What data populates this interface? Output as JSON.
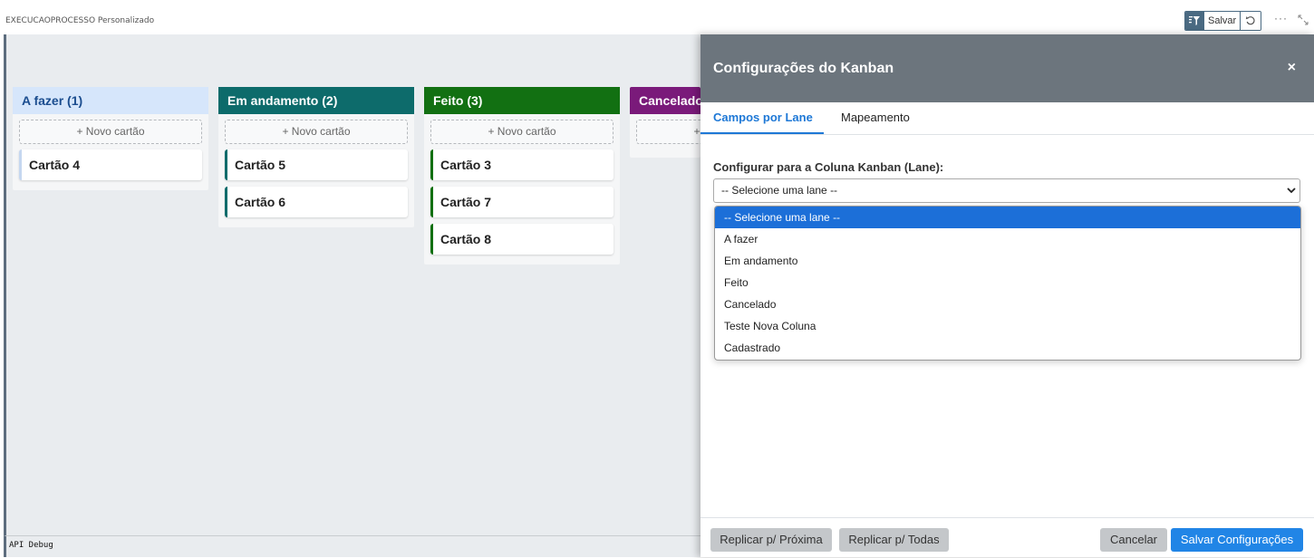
{
  "app": {
    "title": "EXECUCAOPROCESSO Personalizado",
    "save_label": "Salvar",
    "more_label": "···"
  },
  "board": {
    "new_card_label": "+ Novo cartão",
    "lanes": [
      {
        "title": "A fazer (1)",
        "header_bg": "#d6e6fb",
        "header_fg": "#1b4d8f",
        "accent": "#c5d7f0",
        "cards": [
          "Cartão 4"
        ]
      },
      {
        "title": "Em andamento (2)",
        "header_bg": "#0d6b6b",
        "header_fg": "#ffffff",
        "accent": "#0d6b6b",
        "cards": [
          "Cartão 5",
          "Cartão 6"
        ]
      },
      {
        "title": "Feito (3)",
        "header_bg": "#127012",
        "header_fg": "#ffffff",
        "accent": "#127012",
        "cards": [
          "Cartão 3",
          "Cartão 7",
          "Cartão 8"
        ]
      },
      {
        "title": "Cancelado",
        "header_bg": "#7a1a7a",
        "header_fg": "#ffffff",
        "accent": "#7a1a7a",
        "cards": []
      }
    ],
    "api_debug": "API Debug"
  },
  "modal": {
    "title": "Configurações do Kanban",
    "close": "×",
    "tabs": [
      "Campos por Lane",
      "Mapeamento"
    ],
    "field_label": "Configurar para a Coluna Kanban (Lane):",
    "select_value": "-- Selecione uma lane --",
    "options": [
      "-- Selecione uma lane --",
      "A fazer",
      "Em andamento",
      "Feito",
      "Cancelado",
      "Teste Nova Coluna",
      "Cadastrado"
    ],
    "footer": {
      "replicate_next": "Replicar p/ Próxima",
      "replicate_all": "Replicar p/ Todas",
      "cancel": "Cancelar",
      "save": "Salvar Configurações"
    }
  },
  "colors": {
    "accent_blue": "#1e78d6",
    "modal_header": "#6c757d",
    "toolbar": "#4a6a82"
  }
}
